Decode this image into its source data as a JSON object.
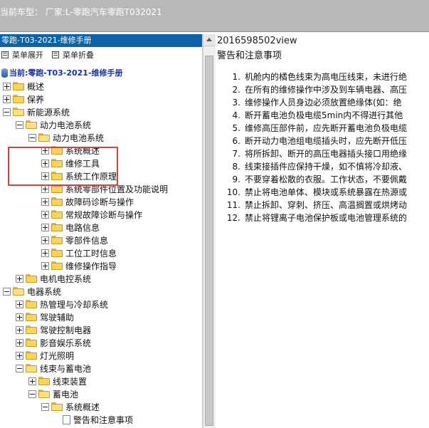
{
  "title_bar": {
    "vehicle": "当前车型： 厂家:L-零跑汽车零跑T032021"
  },
  "left_panel": {
    "header": "零跑-T03-2021-维修手册",
    "expand_all": "菜单展开",
    "collapse_all": "菜单折叠",
    "current_label": "当前:零跑-T03-2021-维修手册",
    "tree": [
      {
        "label": "概述",
        "depth": 0,
        "state": "collapsed"
      },
      {
        "label": "保养",
        "depth": 0,
        "state": "collapsed"
      },
      {
        "label": "新能源系统",
        "depth": 0,
        "state": "expanded"
      },
      {
        "label": "动力电池系统",
        "depth": 1,
        "state": "expanded"
      },
      {
        "label": "动力电池系统",
        "depth": 2,
        "state": "expanded"
      },
      {
        "label": "系统概述",
        "depth": 3,
        "state": "collapsed"
      },
      {
        "label": "维修工具",
        "depth": 3,
        "state": "collapsed"
      },
      {
        "label": "系统工作原理",
        "depth": 3,
        "state": "collapsed"
      },
      {
        "label": "系统零部件位置及功能说明",
        "depth": 3,
        "state": "collapsed"
      },
      {
        "label": "故障码诊断与操作",
        "depth": 3,
        "state": "collapsed"
      },
      {
        "label": "常规故障诊断与操作",
        "depth": 3,
        "state": "collapsed"
      },
      {
        "label": "电路信息",
        "depth": 3,
        "state": "collapsed"
      },
      {
        "label": "零部件信息",
        "depth": 3,
        "state": "collapsed"
      },
      {
        "label": "工位工时信息",
        "depth": 3,
        "state": "collapsed"
      },
      {
        "label": "维修操作指导",
        "depth": 3,
        "state": "collapsed"
      },
      {
        "label": "电机电控系统",
        "depth": 1,
        "state": "collapsed"
      },
      {
        "label": "电器系统",
        "depth": 0,
        "state": "expanded"
      },
      {
        "label": "热管理与冷却系统",
        "depth": 1,
        "state": "collapsed"
      },
      {
        "label": "驾驶辅助",
        "depth": 1,
        "state": "collapsed"
      },
      {
        "label": "驾驶控制电器",
        "depth": 1,
        "state": "collapsed"
      },
      {
        "label": "影音娱乐系统",
        "depth": 1,
        "state": "collapsed"
      },
      {
        "label": "灯光照明",
        "depth": 1,
        "state": "collapsed"
      },
      {
        "label": "线束与蓄电池",
        "depth": 1,
        "state": "expanded"
      },
      {
        "label": "线束装置",
        "depth": 2,
        "state": "collapsed"
      },
      {
        "label": "蓄电池",
        "depth": 2,
        "state": "expanded"
      },
      {
        "label": "系统概述",
        "depth": 3,
        "state": "expanded"
      },
      {
        "label": "警告和注意事项",
        "depth": 4,
        "state": "leaf"
      }
    ]
  },
  "content": {
    "view_id": "2016598502view",
    "heading": "警告和注意事项",
    "items": [
      {
        "num": "1.",
        "text": "机舱内的橘色线束为高电压线束，未进行绝"
      },
      {
        "num": "2.",
        "text": "在所有的维修操作中涉及到车辆电器、高压"
      },
      {
        "num": "3.",
        "text": "维修操作人员身边必须放置绝缘体(如：绝"
      },
      {
        "num": "4.",
        "text": "断开蓄电池负极电缆5min内不得进行其他"
      },
      {
        "num": "5.",
        "text": "维修高压部件前，应先断开蓄电池负极电缆"
      },
      {
        "num": "6.",
        "text": "断开动力电池组电缆插头时，应先断开低压"
      },
      {
        "num": "7.",
        "text": "将所拆卸、断开的高压电器插头接口用绝缘"
      },
      {
        "num": "8.",
        "text": "线束接插件应保持干燥，如不慎将冷却液、"
      },
      {
        "num": "9.",
        "text": "不要穿着松散的衣服。工作状态，不要佩戴"
      },
      {
        "num": "10.",
        "text": "禁止将电池单体、模块或系统暴露在热源或"
      },
      {
        "num": "11.",
        "text": "禁止拆卸、穿刺、挤压、高温搁置或烘烤动"
      },
      {
        "num": "12.",
        "text": "禁止将锂离子电池保护板或电池管理系统的"
      }
    ]
  },
  "colors": {
    "panel_header_bg": "#0e63a8",
    "highlight_box": "#e23b3b",
    "title_bar_bg": "#b8b8b8",
    "current_label": "#1a2fa8"
  },
  "icons": {
    "tree_folder": "folder-icon",
    "tree_page": "page-icon",
    "toggle": "expand-toggle-icon",
    "current": "database-icon"
  }
}
